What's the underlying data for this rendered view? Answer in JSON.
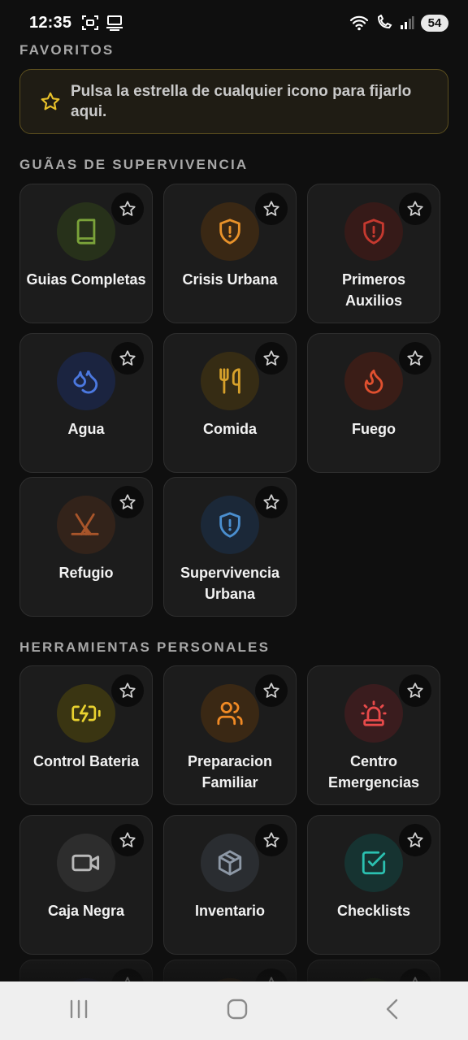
{
  "status_bar": {
    "time": "12:35",
    "battery": "54"
  },
  "favorites": {
    "title": "FAVORITOS",
    "hint": "Pulsa la estrella de cualquier icono para fijarlo aqui."
  },
  "guides": {
    "title": "GUÃ­AS DE SUPERVIVENCIA",
    "items": [
      {
        "label": "Guias Completas",
        "icon": "book-icon",
        "color": "#7ba33a"
      },
      {
        "label": "Crisis Urbana",
        "icon": "shield-alert-icon",
        "color": "#e8922a"
      },
      {
        "label": "Primeros Auxilios",
        "icon": "shield-alert-icon",
        "color": "#c6392f"
      },
      {
        "label": "Agua",
        "icon": "droplets-icon",
        "color": "#4b78e0"
      },
      {
        "label": "Comida",
        "icon": "utensils-icon",
        "color": "#d7a12b"
      },
      {
        "label": "Fuego",
        "icon": "flame-icon",
        "color": "#e0502f"
      },
      {
        "label": "Refugio",
        "icon": "tent-icon",
        "color": "#a8552a"
      },
      {
        "label": "Supervivencia Urbana",
        "icon": "shield-alert-icon",
        "color": "#4b8fcf"
      }
    ]
  },
  "tools": {
    "title": "HERRAMIENTAS PERSONALES",
    "items": [
      {
        "label": "Control Bateria",
        "icon": "battery-charging-icon",
        "color": "#e8d12f"
      },
      {
        "label": "Preparacion Familiar",
        "icon": "users-icon",
        "color": "#f08a25"
      },
      {
        "label": "Centro Emergencias",
        "icon": "siren-icon",
        "color": "#e84a4a"
      },
      {
        "label": "Caja Negra",
        "icon": "video-icon",
        "color": "#b9b9b9"
      },
      {
        "label": "Inventario",
        "icon": "box-icon",
        "color": "#8d98a6"
      },
      {
        "label": "Checklists",
        "icon": "check-square-icon",
        "color": "#2bc0b0"
      }
    ]
  }
}
